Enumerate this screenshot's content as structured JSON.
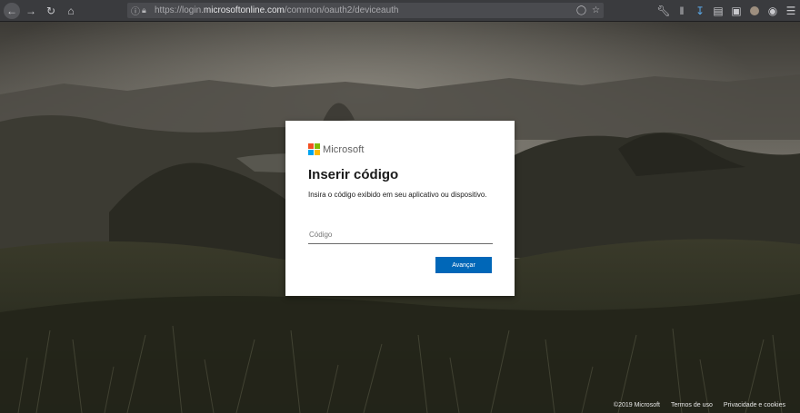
{
  "browser": {
    "url_prefix": "https://login.",
    "url_domain": "microsoftonline.com",
    "url_path": "/common/oauth2/deviceauth"
  },
  "dialog": {
    "brand": "Microsoft",
    "title": "Inserir código",
    "description": "Insira o código exibido em seu aplicativo ou dispositivo.",
    "code_placeholder": "Código",
    "code_value": "",
    "next_label": "Avançar"
  },
  "footer": {
    "copyright": "©2019 Microsoft",
    "terms": "Termos de uso",
    "privacy": "Privacidade e cookies"
  },
  "colors": {
    "accent": "#0067b8",
    "logo_red": "#f25022",
    "logo_green": "#7fba00",
    "logo_blue": "#00a4ef",
    "logo_yellow": "#ffb900"
  },
  "icons": [
    "back-icon",
    "forward-icon",
    "reload-icon",
    "home-icon",
    "info-icon",
    "lock-icon",
    "pocket-icon",
    "bookmark-star-icon",
    "wrench-icon",
    "library-icon",
    "download-icon",
    "reader-icon",
    "screenshot-icon",
    "account-icon",
    "menu-icon"
  ]
}
